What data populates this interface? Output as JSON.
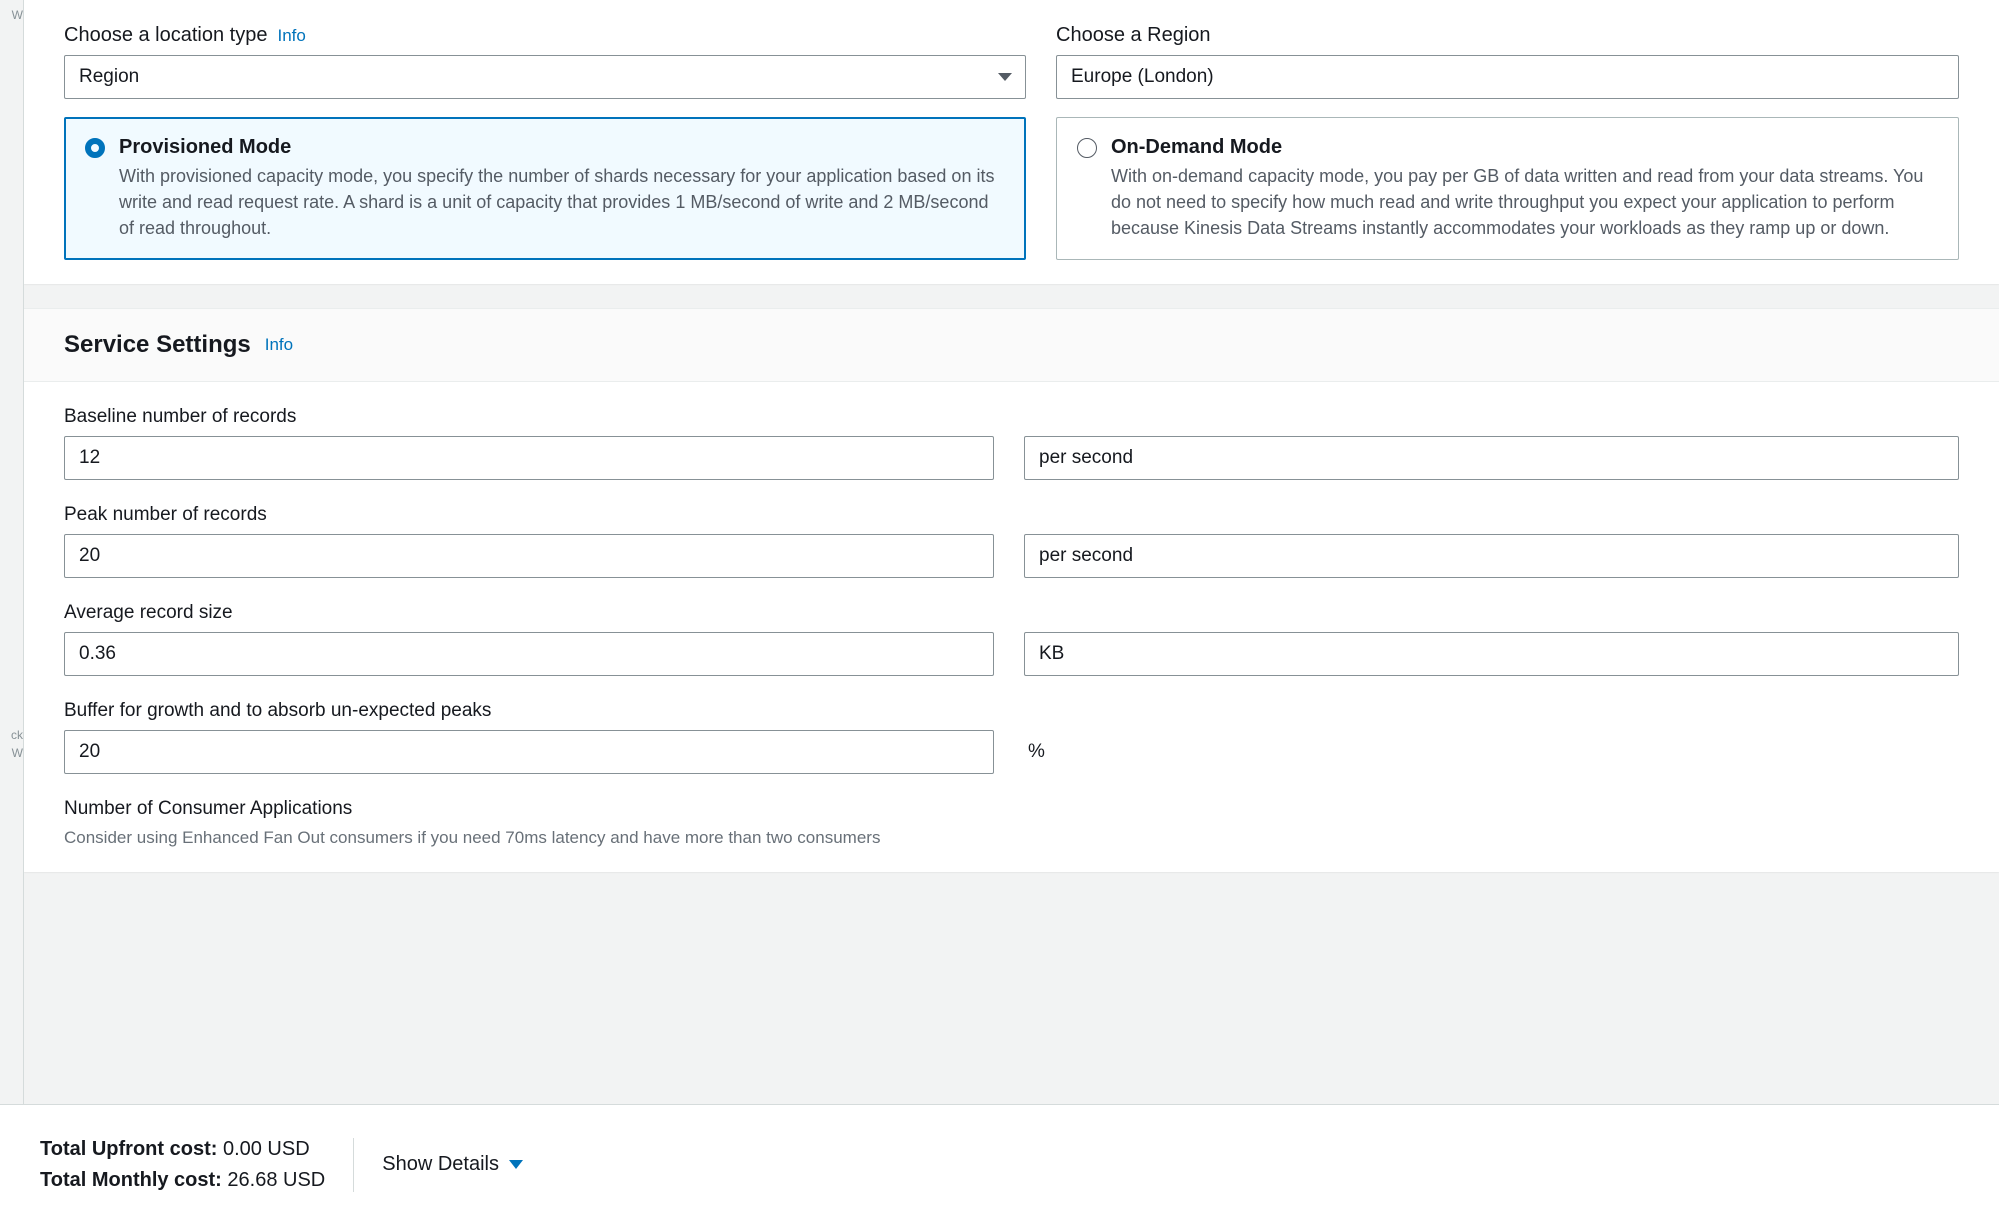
{
  "location": {
    "type_label": "Choose a location type",
    "info": "Info",
    "type_value": "Region",
    "region_label": "Choose a Region",
    "region_value": "Europe (London)"
  },
  "modes": {
    "provisioned": {
      "title": "Provisioned Mode",
      "desc": "With provisioned capacity mode, you specify the number of shards necessary for your application based on its write and read request rate. A shard is a unit of capacity that provides 1 MB/second of write and 2 MB/second of read throughout."
    },
    "ondemand": {
      "title": "On-Demand Mode",
      "desc": "With on-demand capacity mode, you pay per GB of data written and read from your data streams. You do not need to specify how much read and write throughput you expect your application to perform because Kinesis Data Streams instantly accommodates your workloads as they ramp up or down."
    }
  },
  "settings": {
    "title": "Service Settings",
    "info": "Info",
    "baseline": {
      "label": "Baseline number of records",
      "value": "12",
      "unit": "per second"
    },
    "peak": {
      "label": "Peak number of records",
      "value": "20",
      "unit": "per second"
    },
    "avg_size": {
      "label": "Average record size",
      "value": "0.36",
      "unit": "KB"
    },
    "buffer": {
      "label": "Buffer for growth and to absorb un-expected peaks",
      "value": "20",
      "unit": "%"
    },
    "consumers": {
      "label": "Number of Consumer Applications",
      "help": "Consider using Enhanced Fan Out consumers if you need 70ms latency and have more than two consumers"
    }
  },
  "footer": {
    "upfront_label": "Total Upfront cost:",
    "upfront_value": "0.00 USD",
    "monthly_label": "Total Monthly cost:",
    "monthly_value": "26.68 USD",
    "show_details": "Show Details"
  }
}
